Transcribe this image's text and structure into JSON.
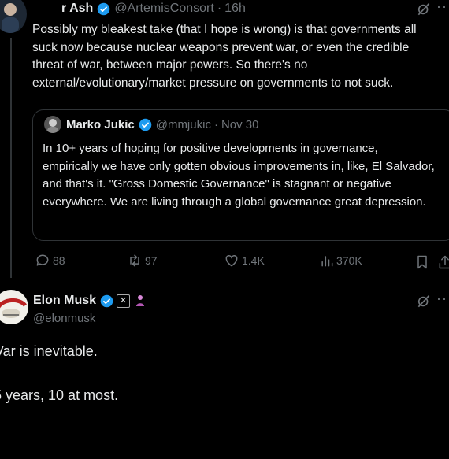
{
  "tweet1": {
    "author_name": "r Ash",
    "handle": "@ArtemisConsort",
    "time": "16h",
    "text": "Possibly my bleakest take (that I hope is wrong) is that governments all suck now because nuclear weapons prevent war, or even the credible threat of war, between major powers. So there's no external/evolutionary/market pressure on governments to not suck.",
    "quote": {
      "author_name": "Marko Jukic",
      "handle": "@mmjukic",
      "time": "Nov 30",
      "text": "In 10+ years of hoping for positive developments in governance, empirically we have only gotten obvious improvements in, like, El Salvador, and that's it. \"Gross Domestic Governance\" is stagnant or negative everywhere. We are living through a global governance great depression."
    },
    "actions": {
      "replies": "88",
      "retweets": "97",
      "likes": "1.4K",
      "views": "370K"
    }
  },
  "tweet2": {
    "author_name": "Elon Musk",
    "handle": "@elonmusk",
    "line1": "Var is inevitable.",
    "line2": "5 years, 10 at most."
  },
  "colors": {
    "verified_blue": "#1d9bf0",
    "text": "#e7e9ea",
    "muted": "#71767b",
    "border": "#2f3336"
  }
}
